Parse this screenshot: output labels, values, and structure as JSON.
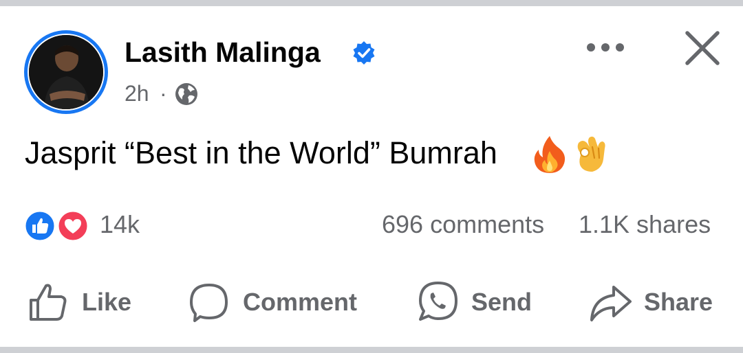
{
  "post": {
    "author": "Lasith Malinga",
    "verified_icon": "verified-badge-icon",
    "time": "2h",
    "separator": "·",
    "audience_icon": "globe-icon",
    "text": "Jasprit “Best in the World” Bumrah",
    "emojis": [
      "fire-emoji",
      "ok-hand-emoji"
    ]
  },
  "header_actions": {
    "more_icon": "more-options-icon",
    "close_icon": "close-icon"
  },
  "stats": {
    "reactions": [
      "like-reaction-icon",
      "love-reaction-icon"
    ],
    "reaction_count": "14k",
    "comments": "696 comments",
    "shares": "1.1K shares"
  },
  "actions": {
    "like": "Like",
    "comment": "Comment",
    "send": "Send",
    "share": "Share"
  },
  "colors": {
    "accent": "#1877f2",
    "love": "#f33e58",
    "secondary_text": "#65676b",
    "primary_text": "#050505"
  }
}
